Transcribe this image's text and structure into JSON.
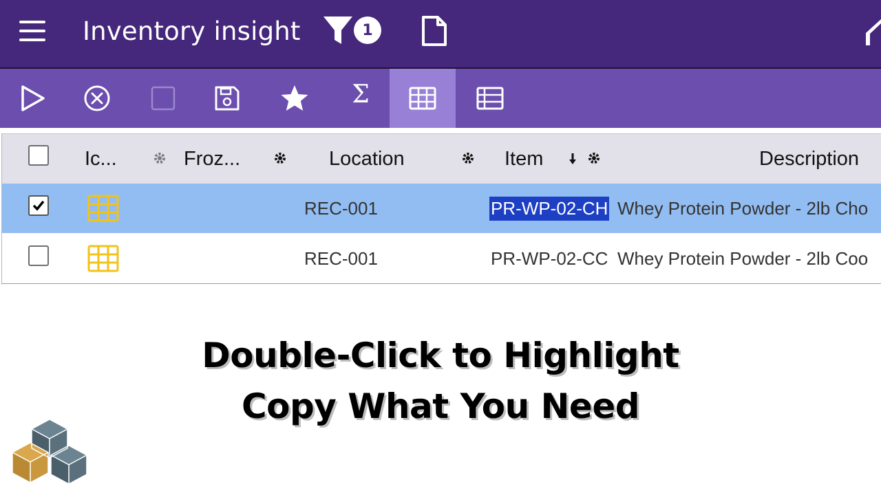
{
  "app": {
    "title": "Inventory insight",
    "filter_count": "1"
  },
  "toolbar": {
    "buttons": [
      "run-icon",
      "cancel-icon",
      "checkbox-icon",
      "save-icon",
      "favorite-star-icon",
      "sum-sigma-icon",
      "grid-view-icon",
      "list-view-icon"
    ],
    "sigma": "Σ",
    "active": "grid-view-icon"
  },
  "grid": {
    "columns": {
      "icon": "Ic...",
      "frozen": "Froz...",
      "location": "Location",
      "item": "Item",
      "description": "Description"
    },
    "sort": {
      "column": "Item",
      "direction": "descending"
    },
    "rows": [
      {
        "selected": true,
        "location": "REC-001",
        "item": "PR-WP-02-CH",
        "description": "Whey Protein Powder - 2lb Cho"
      },
      {
        "selected": false,
        "location": "REC-001",
        "item": "PR-WP-02-CC",
        "description": "Whey Protein Powder - 2lb Coo"
      }
    ]
  },
  "caption": {
    "line1": "Double-Click to Highlight",
    "line2": "Copy What You Need"
  },
  "colors": {
    "topbar": "#45277c",
    "toolbar": "#6b4eae",
    "toolbar_active": "#9880d6",
    "header_row": "#e2e0e8",
    "selected_row": "#92bdf2",
    "highlight": "#1c3fc4",
    "row_icon": "#f2c21b"
  }
}
